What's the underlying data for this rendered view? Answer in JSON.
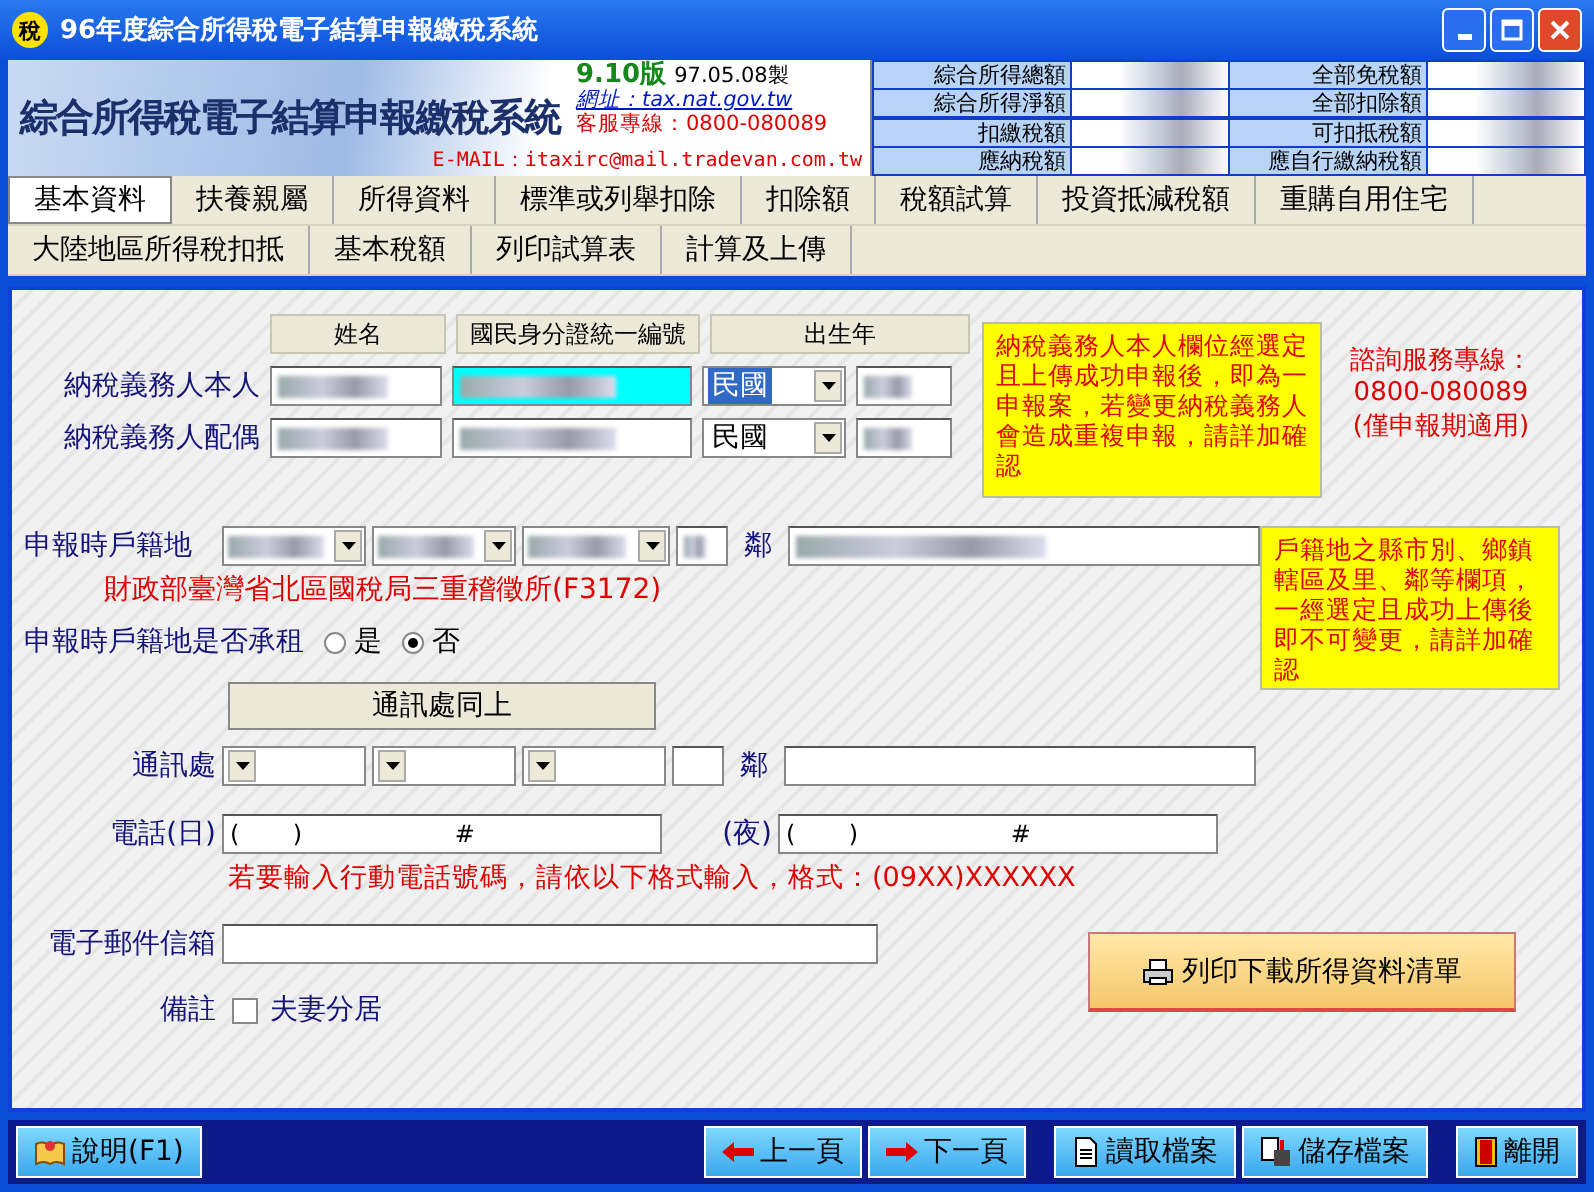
{
  "window": {
    "title": "96年度綜合所得稅電子結算申報繳稅系統",
    "app_icon": "稅"
  },
  "header": {
    "banner_title": "綜合所得稅電子結算申報繳稅系統",
    "version": "9.10版",
    "build_date": "97.05.08製",
    "website": "網址：tax.nat.gov.tw",
    "service_line": "客服專線：0800-080089",
    "email": "E-MAIL：itaxirc@mail.tradevan.com.tw"
  },
  "summary": [
    {
      "label": "綜合所得總額"
    },
    {
      "label": "全部免稅額"
    },
    {
      "label": "綜合所得淨額"
    },
    {
      "label": "全部扣除額"
    },
    {
      "label": "扣繳稅額"
    },
    {
      "label": "可扣抵稅額"
    },
    {
      "label": "應納稅額"
    },
    {
      "label": "應自行繳納稅額"
    }
  ],
  "tab_rows": [
    [
      {
        "label": "基本資料",
        "selected": true
      },
      {
        "label": "扶養親屬",
        "selected": false
      },
      {
        "label": "所得資料",
        "selected": false
      },
      {
        "label": "標準或列舉扣除",
        "selected": false
      },
      {
        "label": "扣除額",
        "selected": false
      },
      {
        "label": "稅額試算",
        "selected": false
      },
      {
        "label": "投資抵減稅額",
        "selected": false
      },
      {
        "label": "重購自用住宅",
        "selected": false
      }
    ],
    [
      {
        "label": "大陸地區所得稅扣抵",
        "selected": false
      },
      {
        "label": "基本稅額",
        "selected": false
      },
      {
        "label": "列印試算表",
        "selected": false
      },
      {
        "label": "計算及上傳",
        "selected": false
      }
    ]
  ],
  "form": {
    "columns": [
      "姓名",
      "國民身分證統一編號",
      "出生年"
    ],
    "persons": [
      {
        "label": "納稅義務人本人",
        "era": "民國",
        "id_focused": true,
        "era_selected": true
      },
      {
        "label": "納稅義務人配偶",
        "era": "民國",
        "id_focused": false,
        "era_selected": false
      }
    ],
    "notice_1": "納稅義務人本人欄位經選定且上傳成功申報後，即為一申報案，若變更納稅義務人會造成重複申報，請詳加確認",
    "hotline": [
      "諮詢服務專線：",
      "0800-080089",
      "(僅申報期適用)"
    ],
    "household": {
      "label": "申報時戶籍地",
      "lin": "鄰",
      "office": "財政部臺灣省北區國稅局三重稽徵所(F3172)"
    },
    "notice_2": "戶籍地之縣市別、鄉鎮轄區及里、鄰等欄項，一經選定且成功上傳後即不可變更，請詳加確認",
    "rent": {
      "label": "申報時戶籍地是否承租",
      "options": [
        {
          "label": "是",
          "selected": false
        },
        {
          "label": "否",
          "selected": true
        }
      ]
    },
    "same_button": "通訊處同上",
    "mail": {
      "label": "通訊處",
      "lin": "鄰"
    },
    "phone": {
      "day_label": "電話(日)",
      "day_value": "(       )                    #",
      "night_label": "(夜)",
      "night_value": "(       )                    #",
      "hint": "若要輸入行動電話號碼，請依以下格式輸入，格式：(09XX)XXXXXX"
    },
    "email_label": "電子郵件信箱",
    "print_button": "列印下載所得資料清單",
    "remark": {
      "label": "備註",
      "option": "夫妻分居",
      "checked": false
    }
  },
  "footer": {
    "help": "說明(F1)",
    "prev": "上一頁",
    "next": "下一頁",
    "open": "讀取檔案",
    "save": "儲存檔案",
    "exit": "離開"
  }
}
